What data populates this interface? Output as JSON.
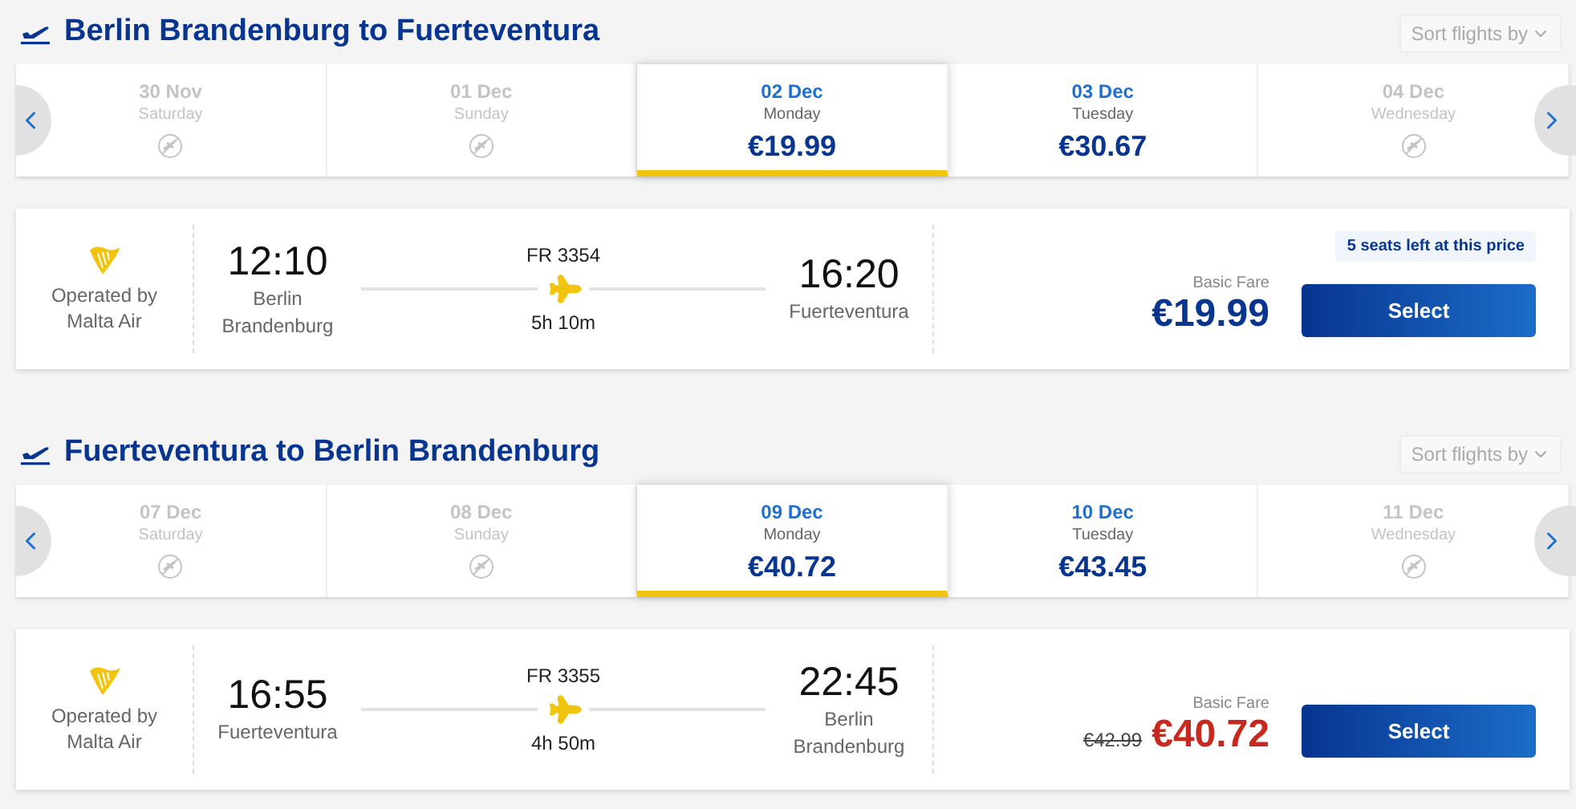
{
  "sections": [
    {
      "title": "Berlin Brandenburg to Fuerteventura",
      "sort_label": "Sort flights by",
      "dates": [
        {
          "date": "30 Nov",
          "weekday": "Saturday",
          "available": false,
          "selected": false
        },
        {
          "date": "01 Dec",
          "weekday": "Sunday",
          "available": false,
          "selected": false
        },
        {
          "date": "02 Dec",
          "weekday": "Monday",
          "price": "€19.99",
          "available": true,
          "selected": true
        },
        {
          "date": "03 Dec",
          "weekday": "Tuesday",
          "price": "€30.67",
          "available": true,
          "selected": false
        },
        {
          "date": "04 Dec",
          "weekday": "Wednesday",
          "available": false,
          "selected": false
        }
      ],
      "flight": {
        "operator_label": "Operated by",
        "operator": "Malta Air",
        "departure_time": "12:10",
        "departure_airport": "Berlin Brandenburg",
        "flight_number": "FR 3354",
        "duration": "5h 10m",
        "arrival_time": "16:20",
        "arrival_airport": "Fuerteventura",
        "seats_notice": "5 seats left at this price",
        "fare_label": "Basic Fare",
        "price": "€19.99",
        "discounted": false,
        "button": "Select"
      }
    },
    {
      "title": "Fuerteventura to Berlin Brandenburg",
      "sort_label": "Sort flights by",
      "dates": [
        {
          "date": "07 Dec",
          "weekday": "Saturday",
          "available": false,
          "selected": false
        },
        {
          "date": "08 Dec",
          "weekday": "Sunday",
          "available": false,
          "selected": false
        },
        {
          "date": "09 Dec",
          "weekday": "Monday",
          "price": "€40.72",
          "available": true,
          "selected": true
        },
        {
          "date": "10 Dec",
          "weekday": "Tuesday",
          "price": "€43.45",
          "available": true,
          "selected": false
        },
        {
          "date": "11 Dec",
          "weekday": "Wednesday",
          "available": false,
          "selected": false
        }
      ],
      "flight": {
        "operator_label": "Operated by",
        "operator": "Malta Air",
        "departure_time": "16:55",
        "departure_airport": "Fuerteventura",
        "flight_number": "FR 3355",
        "duration": "4h 50m",
        "arrival_time": "22:45",
        "arrival_airport": "Berlin Brandenburg",
        "fare_label": "Basic Fare",
        "old_price": "€42.99",
        "price": "€40.72",
        "discounted": true,
        "button": "Select"
      }
    }
  ]
}
